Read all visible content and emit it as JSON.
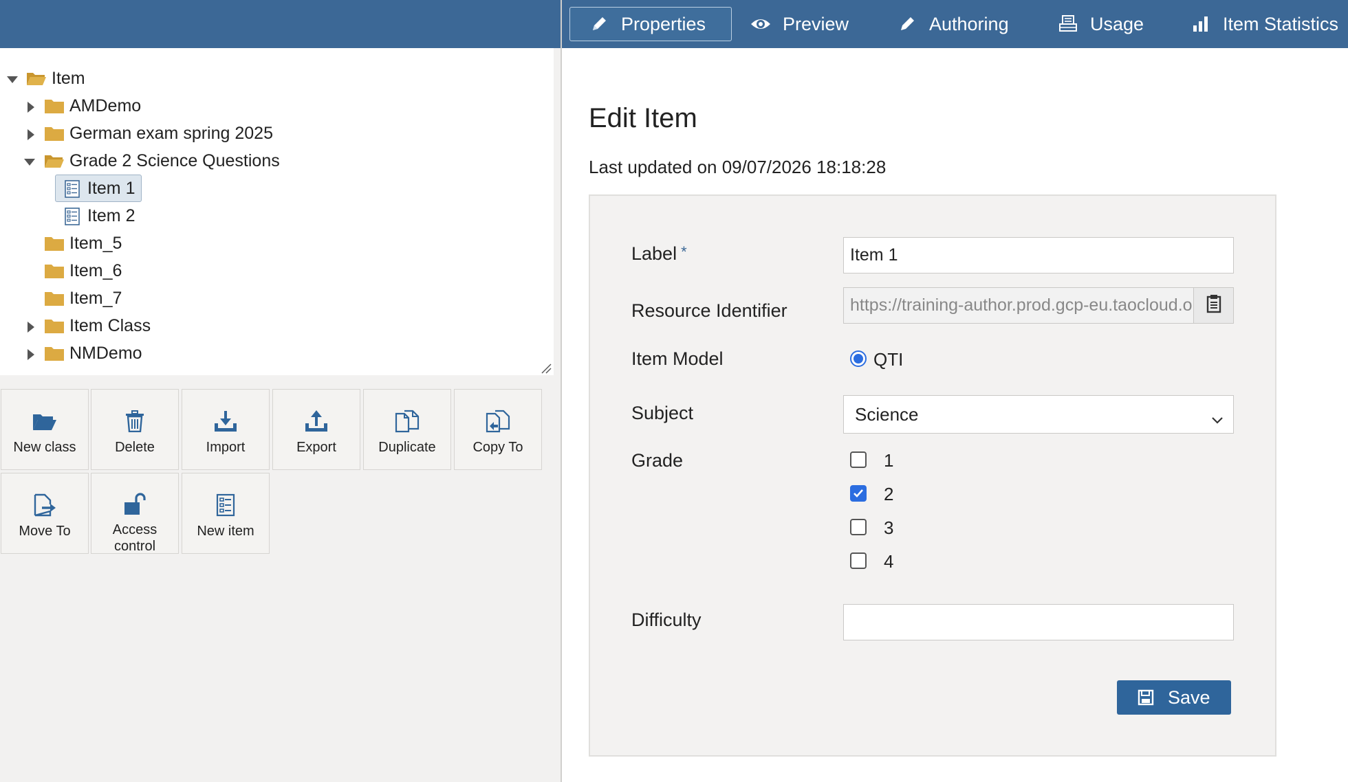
{
  "tree": {
    "root": {
      "label": "Item"
    },
    "children": [
      {
        "label": "AMDemo"
      },
      {
        "label": "German exam spring 2025"
      },
      {
        "label": "Grade 2 Science Questions"
      },
      {
        "label": "Item_5"
      },
      {
        "label": "Item_6"
      },
      {
        "label": "Item_7"
      },
      {
        "label": "Item Class"
      },
      {
        "label": "NMDemo"
      }
    ],
    "grade2_children": [
      {
        "label": "Item 1"
      },
      {
        "label": "Item 2"
      }
    ]
  },
  "actions": {
    "new_class": "New class",
    "delete": "Delete",
    "import": "Import",
    "export": "Export",
    "duplicate": "Duplicate",
    "copy_to": "Copy To",
    "move_to": "Move To",
    "access_control": "Access control",
    "new_item": "New item"
  },
  "tabs": {
    "properties": "Properties",
    "preview": "Preview",
    "authoring": "Authoring",
    "usage": "Usage",
    "item_statistics": "Item Statistics"
  },
  "page": {
    "title": "Edit Item",
    "last_updated": "Last updated on 09/07/2026 18:18:28"
  },
  "form": {
    "label_label": "Label",
    "required_mark": "*",
    "label_value": "Item 1",
    "resource_identifier_label": "Resource Identifier",
    "resource_identifier_value": "https://training-author.prod.gcp-eu.taocloud.org/",
    "item_model_label": "Item Model",
    "item_model_value": "QTI",
    "subject_label": "Subject",
    "subject_value": "Science",
    "grade_label": "Grade",
    "grades": [
      {
        "value": "1",
        "checked": false
      },
      {
        "value": "2",
        "checked": true
      },
      {
        "value": "3",
        "checked": false
      },
      {
        "value": "4",
        "checked": false
      }
    ],
    "difficulty_label": "Difficulty",
    "difficulty_value": "",
    "save_label": "Save"
  },
  "colors": {
    "topbar": "#3c6896",
    "folder": "#d9a93c",
    "accent": "#2b6de0",
    "icon_blue": "#2f659b"
  }
}
